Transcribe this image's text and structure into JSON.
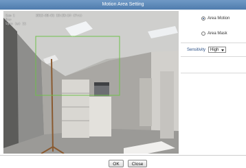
{
  "dialog": {
    "title": "Motion Area Setting"
  },
  "camera": {
    "osd_name": "Cam 1",
    "osd_timestamp": "2012-08-01 10:29:14 (Fri)",
    "osd_extra": "Now",
    "osd_subtitle": "Sync (s) 11"
  },
  "panel": {
    "options": [
      {
        "label": "Area Motion",
        "selected": true
      },
      {
        "label": "Area Mask",
        "selected": false
      }
    ],
    "sensitivity_label": "Sensitivity",
    "sensitivity_value": "High"
  },
  "buttons": {
    "ok": "OK",
    "close": "Close"
  },
  "colors": {
    "title_bar": "#5a86b6",
    "region_outline": "#6fc04a"
  }
}
